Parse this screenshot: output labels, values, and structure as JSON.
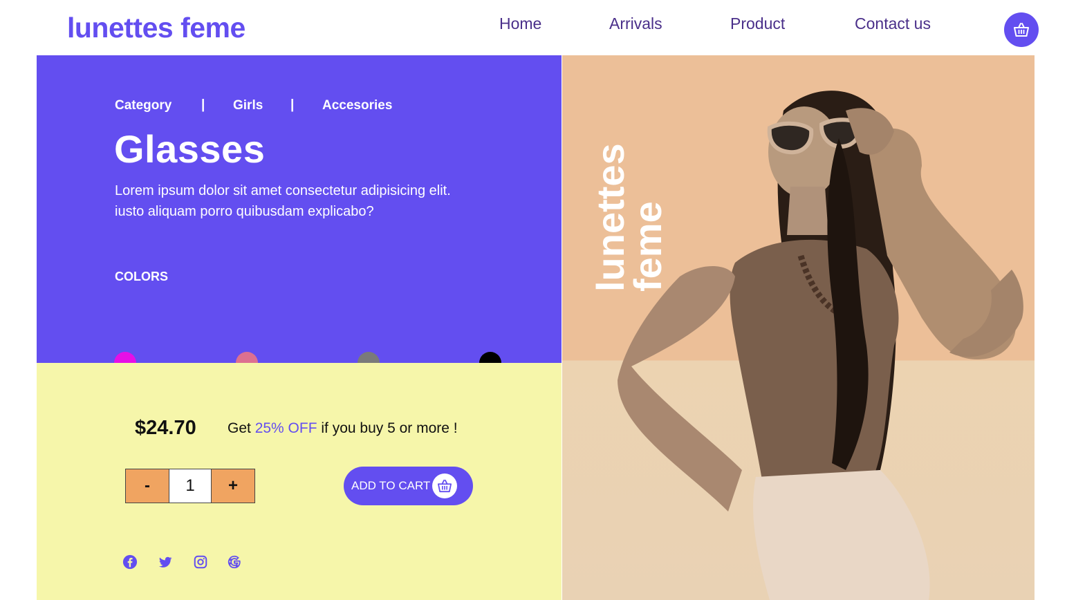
{
  "brand": "lunettes feme",
  "nav": {
    "items": [
      "Home",
      "Arrivals",
      "Product",
      "Contact us"
    ]
  },
  "cart_icon": "basket-icon",
  "breadcrumb": {
    "items": [
      "Category",
      "Girls",
      "Accesories"
    ],
    "separator": "|"
  },
  "product": {
    "title": "Glasses",
    "description_line1": "Lorem ipsum dolor sit amet consectetur adipisicing elit.",
    "description_line2": "iusto aliquam porro quibusdam explicabo?",
    "colors_label": "COLORS",
    "colors": [
      "#e60fe6",
      "#dd7090",
      "#7a7a7a",
      "#000000"
    ],
    "price": "$24.70",
    "promo": {
      "prefix": "Get ",
      "highlight": "25% OFF",
      "suffix": " if you buy 5 or more !"
    },
    "quantity": {
      "minus": "-",
      "value": "1",
      "plus": "+"
    },
    "add_to_cart": "ADD TO CART"
  },
  "hero_text": [
    "lunettes",
    "feme"
  ],
  "social_icons": [
    "facebook-icon",
    "twitter-icon",
    "instagram-icon",
    "google-icon"
  ],
  "colors": {
    "accent": "#634ef0",
    "panel_yellow": "#f6f6aa",
    "qty_button": "#f0a461",
    "photo_bg": "#ecbf98"
  }
}
